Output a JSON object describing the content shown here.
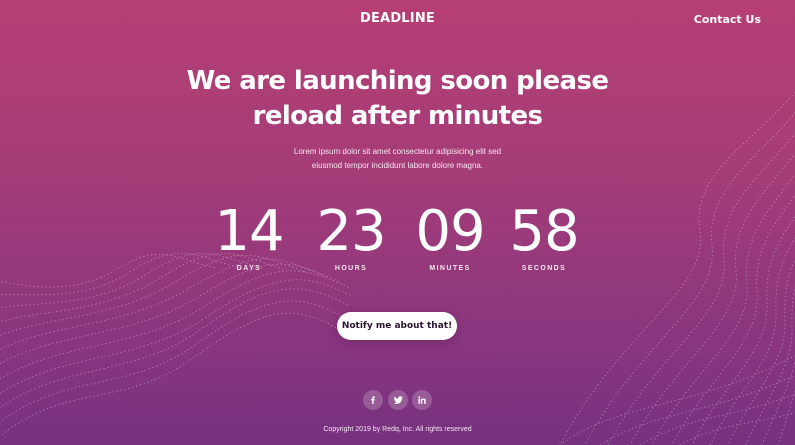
{
  "header": {
    "brand": "DEADLINE",
    "contact_label": "Contact Us"
  },
  "hero": {
    "headline_line1": "We are launching soon please",
    "headline_line2": "reload after minutes",
    "subtext_line1": "Lorem ipsum dolor sit amet consectetur adipisicing elit sed",
    "subtext_line2": "eiusmod tempor incididunt labore dolore magna."
  },
  "countdown": {
    "days": {
      "value": "14",
      "label": "DAYS"
    },
    "hours": {
      "value": "23",
      "label": "HOURS"
    },
    "minutes": {
      "value": "09",
      "label": "MINUTES"
    },
    "seconds": {
      "value": "58",
      "label": "SECONDS"
    }
  },
  "cta": {
    "notify_label": "Notify me about that!"
  },
  "social": {
    "icons": [
      "facebook-icon",
      "twitter-icon",
      "linkedin-icon"
    ]
  },
  "footer": {
    "copyright": "Copyright 2019 by Redq, Inc. All rights reserved"
  },
  "colors": {
    "gradient_top": "#b63f74",
    "gradient_bottom": "#76317f",
    "button_bg": "#ffffff",
    "button_text": "#2b1530"
  }
}
